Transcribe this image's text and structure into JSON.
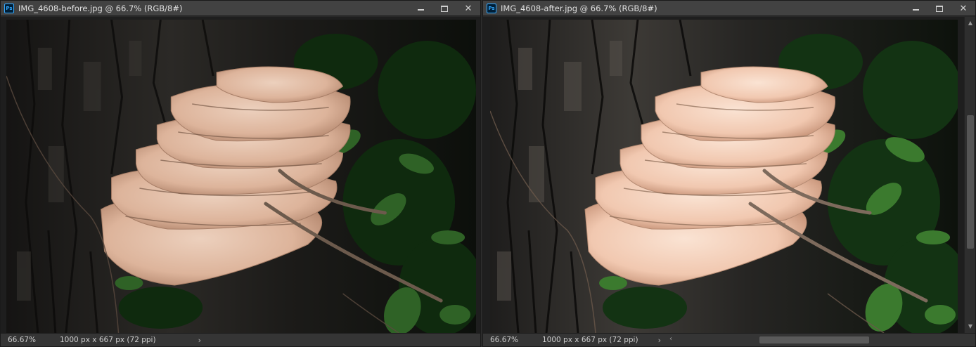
{
  "windows": [
    {
      "title": "IMG_4608-before.jpg @ 66.7% (RGB/8#)",
      "zoom": "66.67%",
      "doc_info": "1000 px x 667 px (72 ppi)"
    },
    {
      "title": "IMG_4608-after.jpg @ 66.7% (RGB/8#)",
      "zoom": "66.67%",
      "doc_info": "1000 px x 667 px (72 ppi)"
    }
  ],
  "app_icon_label": "Ps",
  "controls": {
    "minimize": "minimize",
    "maximize": "maximize",
    "close": "✕"
  },
  "arrows": {
    "right": "›",
    "left": "‹",
    "up": "▲",
    "down": "▼"
  },
  "colors": {
    "bark_dark": "#1b1a19",
    "bark_light": "#3e3b38",
    "leaf_dark": "#0f1e0e",
    "leaf_mid": "#2d5a24",
    "fungus_before": "#e6c2ac",
    "fungus_after": "#f4d3be",
    "accent_ps": "#31a8ff"
  }
}
